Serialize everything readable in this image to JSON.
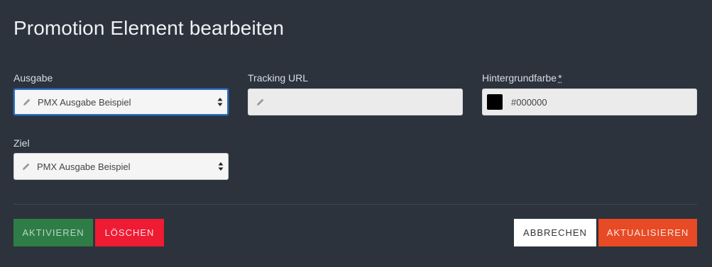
{
  "dialog": {
    "title": "Promotion Element bearbeiten"
  },
  "form": {
    "ausgabe": {
      "label": "Ausgabe",
      "value": "PMX Ausgabe Beispiel"
    },
    "tracking_url": {
      "label": "Tracking URL",
      "value": ""
    },
    "hintergrundfarbe": {
      "label": "Hintergrundfarbe",
      "required_marker": "*",
      "value": "#000000",
      "swatch_color": "#000000"
    },
    "ziel": {
      "label": "Ziel",
      "value": "PMX Ausgabe Beispiel"
    }
  },
  "actions": {
    "activate_label": "AKTIVIEREN",
    "delete_label": "LÖSCHEN",
    "cancel_label": "ABBRECHEN",
    "update_label": "AKTUALISIEREN"
  },
  "colors": {
    "background": "#2c333c",
    "activate": "#2f7d46",
    "delete": "#ee1b33",
    "update": "#e84a25",
    "focus": "#2d6fc5"
  },
  "icons": [
    "pencil-icon",
    "select-arrows-icon"
  ]
}
